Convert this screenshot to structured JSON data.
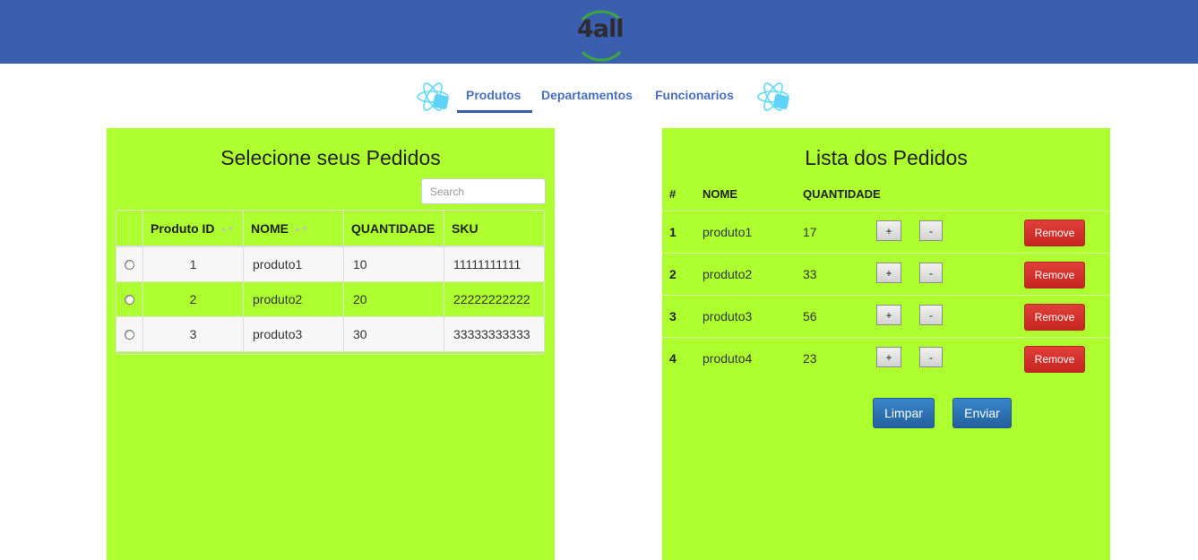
{
  "header": {
    "logo_text": "4all",
    "brand_color": "#3b5faf"
  },
  "nav": {
    "items": [
      "Produtos",
      "Departamentos",
      "Funcionarios"
    ],
    "active": "Produtos"
  },
  "left_panel": {
    "title": "Selecione seus Pedidos",
    "search_placeholder": "Search",
    "columns": [
      "Produto ID",
      "NOME",
      "QUANTIDADE",
      "SKU"
    ],
    "rows": [
      {
        "id": "1",
        "nome": "produto1",
        "quantidade": "10",
        "sku": "11111111111"
      },
      {
        "id": "2",
        "nome": "produto2",
        "quantidade": "20",
        "sku": "22222222222"
      },
      {
        "id": "3",
        "nome": "produto3",
        "quantidade": "30",
        "sku": "33333333333"
      }
    ]
  },
  "right_panel": {
    "title": "Lista dos Pedidos",
    "columns": [
      "#",
      "NOME",
      "QUANTIDADE"
    ],
    "rows": [
      {
        "num": "1",
        "nome": "produto1",
        "quantidade": "17"
      },
      {
        "num": "2",
        "nome": "produto2",
        "quantidade": "33"
      },
      {
        "num": "3",
        "nome": "produto3",
        "quantidade": "56"
      },
      {
        "num": "4",
        "nome": "produto4",
        "quantidade": "23"
      }
    ],
    "plus_label": "+",
    "minus_label": "-",
    "remove_label": "Remove",
    "clear_label": "Limpar",
    "send_label": "Enviar"
  },
  "colors": {
    "panel_bg": "#adff2f",
    "remove": "#d9342b",
    "primary": "#2a6fae",
    "link": "#4a6fc1"
  }
}
